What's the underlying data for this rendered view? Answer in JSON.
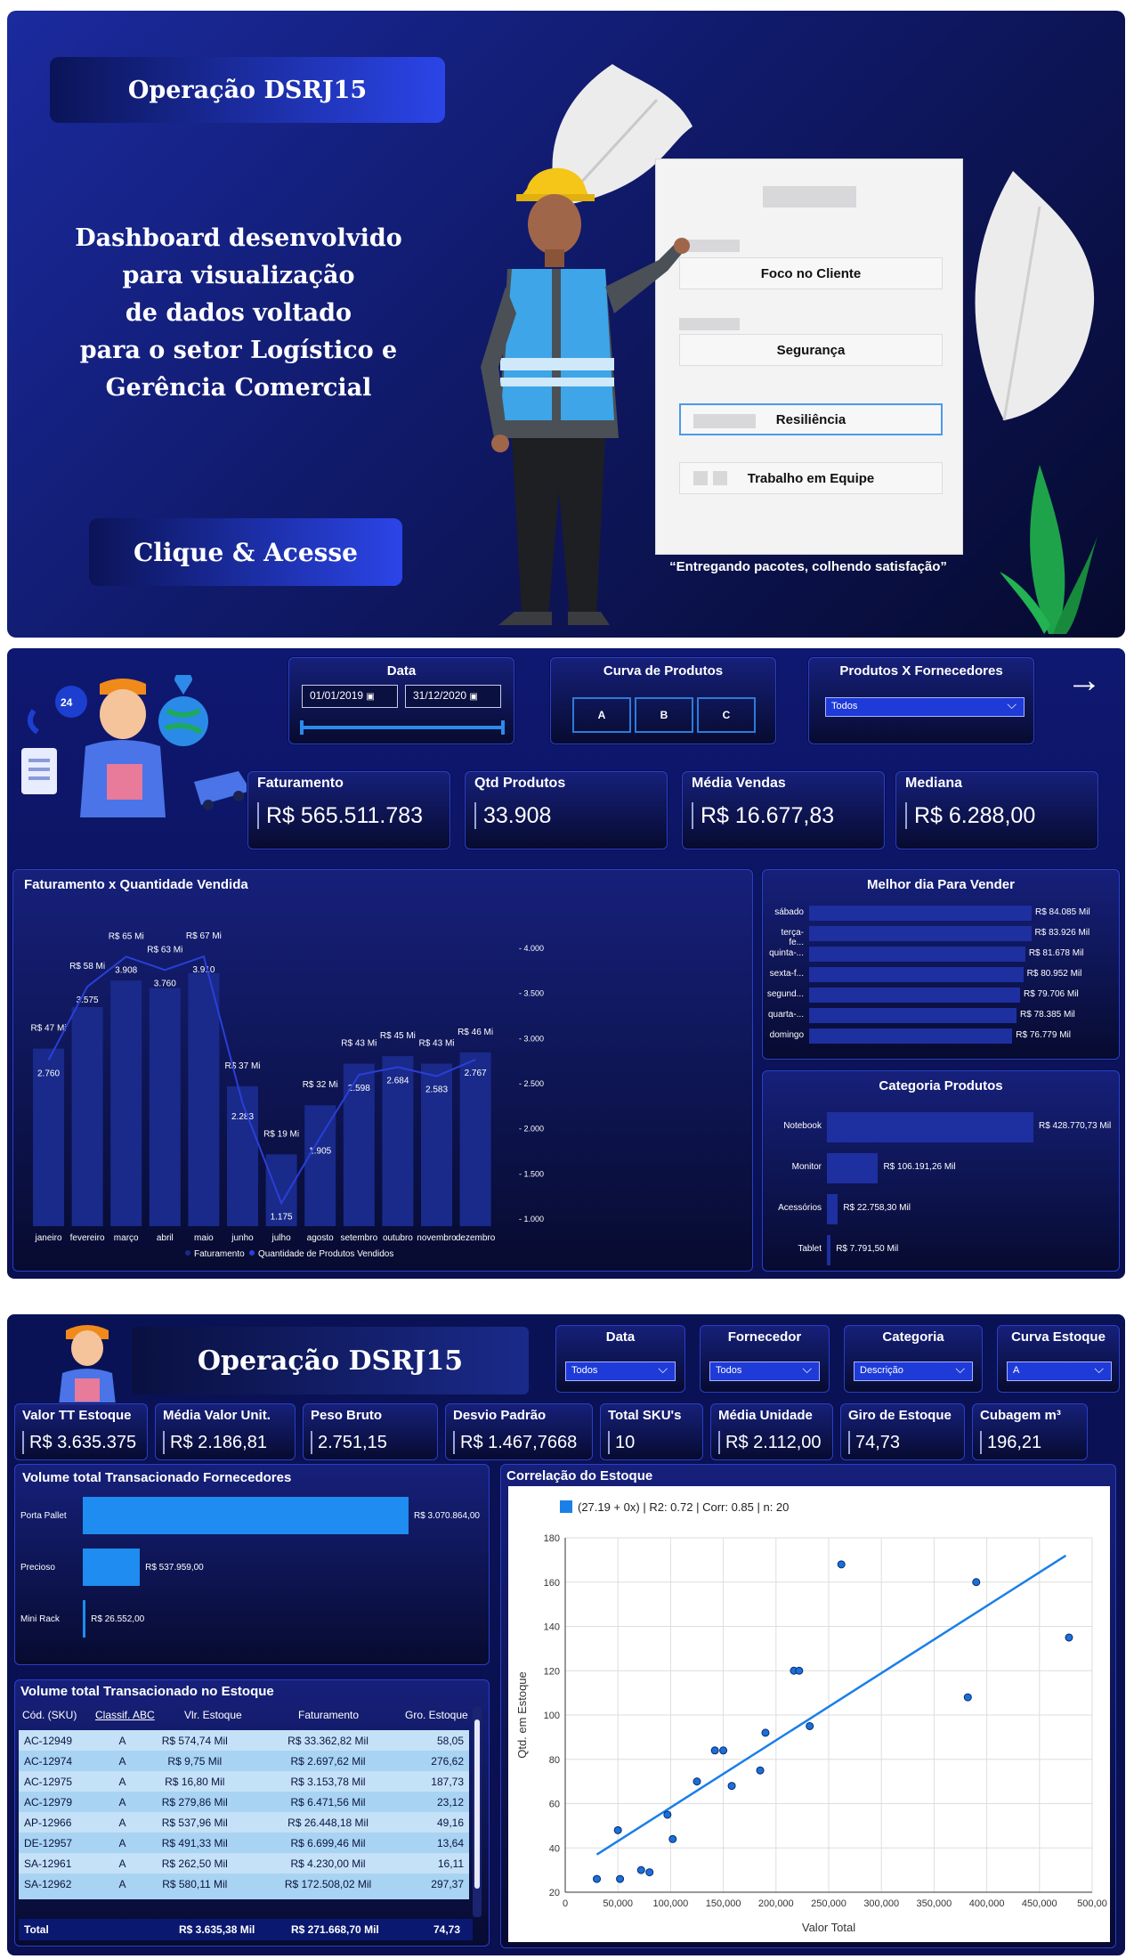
{
  "cover": {
    "title": "Operação DSRJ15",
    "description_lines": [
      "Dashboard desenvolvido",
      "para visualização",
      "de dados voltado",
      "para o setor Logístico e",
      "Gerência Comercial"
    ],
    "cta": "Clique & Acesse",
    "doc_fields": [
      "Foco no Cliente",
      "Segurança",
      "Resiliência",
      "Trabalho em Equipe"
    ],
    "quote": "“Entregando  pacotes, colhendo satisfação”"
  },
  "sales": {
    "filters": {
      "date_title": "Data",
      "date_from": "01/01/2019",
      "date_to": "31/12/2020",
      "curve_title": "Curva de Produtos",
      "curve_tiles": [
        "A",
        "B",
        "C"
      ],
      "supplier_title": "Produtos X Fornecedores",
      "supplier_value": "Todos",
      "arrow": "→"
    },
    "kpis": [
      {
        "title": "Faturamento",
        "value": "R$ 565.511.783"
      },
      {
        "title": "Qtd Produtos",
        "value": "33.908"
      },
      {
        "title": "Média Vendas",
        "value": "R$ 16.677,83"
      },
      {
        "title": "Mediana",
        "value": "R$ 6.288,00"
      }
    ],
    "revenue_title": "Faturamento x Quantidade Vendida",
    "best_day_title": "Melhor dia Para Vender",
    "category_title": "Categoria Produtos"
  },
  "stock": {
    "title": "Operação DSRJ15",
    "filters": [
      {
        "title": "Data",
        "value": "Todos"
      },
      {
        "title": "Fornecedor",
        "value": "Todos"
      },
      {
        "title": "Categoria",
        "value": "Descrição"
      },
      {
        "title": "Curva Estoque",
        "value": "A"
      }
    ],
    "kpis": [
      {
        "title": "Valor TT Estoque",
        "value": "R$ 3.635.375"
      },
      {
        "title": "Média Valor Unit.",
        "value": "R$ 2.186,81"
      },
      {
        "title": "Peso Bruto",
        "value": "2.751,15"
      },
      {
        "title": "Desvio Padrão",
        "value": "R$ 1.467,7668"
      },
      {
        "title": "Total SKU's",
        "value": "10"
      },
      {
        "title": "Média Unidade",
        "value": "R$ 2.112,00"
      },
      {
        "title": "Giro de Estoque",
        "value": "74,73"
      },
      {
        "title": "Cubagem m³",
        "value": "196,21"
      }
    ],
    "supplier_volume_title": "Volume total Transacionado Fornecedores",
    "table": {
      "title": "Volume total Transacionado no Estoque",
      "headers": [
        "Cód. (SKU)",
        "Classif. ABC",
        "Vlr. Estoque",
        "Faturamento",
        "Gro. Estoque"
      ],
      "rows": [
        [
          "AC-12949",
          "A",
          "R$ 574,74 Mil",
          "R$ 33.362,82 Mil",
          "58,05"
        ],
        [
          "AC-12974",
          "A",
          "R$ 9,75 Mil",
          "R$ 2.697,62 Mil",
          "276,62"
        ],
        [
          "AC-12975",
          "A",
          "R$ 16,80 Mil",
          "R$ 3.153,78 Mil",
          "187,73"
        ],
        [
          "AC-12979",
          "A",
          "R$ 279,86 Mil",
          "R$ 6.471,56 Mil",
          "23,12"
        ],
        [
          "AP-12966",
          "A",
          "R$ 537,96 Mil",
          "R$ 26.448,18 Mil",
          "49,16"
        ],
        [
          "DE-12957",
          "A",
          "R$ 491,33 Mil",
          "R$ 6.699,46 Mil",
          "13,64"
        ],
        [
          "SA-12961",
          "A",
          "R$ 262,50 Mil",
          "R$ 4.230,00 Mil",
          "16,11"
        ],
        [
          "SA-12962",
          "A",
          "R$ 580,11 Mil",
          "R$ 172.508,02 Mil",
          "297,37"
        ]
      ],
      "total": [
        "Total",
        "",
        "R$ 3.635,38 Mil",
        "R$ 271.668,70 Mil",
        "74,73"
      ]
    },
    "scatter_title": "Correlação do Estoque"
  },
  "chart_data": [
    {
      "type": "bar",
      "title": "Faturamento x Quantidade Vendida",
      "categories": [
        "janeiro",
        "fevereiro",
        "março",
        "abril",
        "maio",
        "junho",
        "julho",
        "agosto",
        "setembro",
        "outubro",
        "novembro",
        "dezembro"
      ],
      "series": [
        {
          "name": "Faturamento",
          "values": [
            47,
            58,
            65,
            63,
            67,
            37,
            19,
            32,
            43,
            45,
            43,
            46
          ],
          "labels": [
            "R$ 47 Mi",
            "R$ 58 Mi",
            "R$ 65 Mi",
            "R$ 63 Mi",
            "R$ 67 Mi",
            "R$ 37 Mi",
            "R$ 19 Mi",
            "R$ 32 Mi",
            "R$ 43 Mi",
            "R$ 45 Mi",
            "R$ 43 Mi",
            "R$ 46 Mi"
          ],
          "color": "#1a2a8a"
        },
        {
          "name": "Quantidade de Produtos Vendidos",
          "type": "line",
          "values": [
            2760,
            3575,
            3908,
            3760,
            3910,
            2283,
            1175,
            1905,
            2598,
            2684,
            2583,
            2767
          ],
          "labels": [
            "2.760",
            "3.575",
            "3.908",
            "3.760",
            "3.910",
            "2.283",
            "1.175",
            "1.905",
            "2.598",
            "2.684",
            "2.583",
            "2.767"
          ],
          "color": "#2a3fd8"
        }
      ],
      "y2_ticks": [
        "4.000",
        "3.500",
        "3.000",
        "2.500",
        "2.000",
        "1.500",
        "1.000"
      ],
      "y2lim": [
        1000,
        4000
      ],
      "legend": "bottom"
    },
    {
      "type": "bar",
      "orientation": "horizontal",
      "title": "Melhor dia Para Vender",
      "categories": [
        "sábado",
        "terça-fe...",
        "quinta-...",
        "sexta-f...",
        "segund...",
        "quarta-...",
        "domingo"
      ],
      "values": [
        84085,
        83926,
        81678,
        80952,
        79706,
        78385,
        76779
      ],
      "labels": [
        "R$ 84.085 Mil",
        "R$ 83.926 Mil",
        "R$ 81.678 Mil",
        "R$ 80.952 Mil",
        "R$ 79.706 Mil",
        "R$ 78.385 Mil",
        "R$ 76.779 Mil"
      ]
    },
    {
      "type": "bar",
      "orientation": "horizontal",
      "title": "Categoria Produtos",
      "categories": [
        "Notebook",
        "Monitor",
        "Acessórios",
        "Tablet"
      ],
      "values": [
        428770.73,
        106191.26,
        22758.3,
        7791.5
      ],
      "labels": [
        "R$ 428.770,73 Mil",
        "R$ 106.191,26 Mil",
        "R$ 22.758,30 Mil",
        "R$ 7.791,50 Mil"
      ]
    },
    {
      "type": "bar",
      "orientation": "horizontal",
      "title": "Volume total Transacionado Fornecedores",
      "categories": [
        "Porta Pallet",
        "Precioso",
        "Mini Rack"
      ],
      "values": [
        3070864.0,
        537959.0,
        26552.0
      ],
      "labels": [
        "R$ 3.070.864,00",
        "R$ 537.959,00",
        "R$ 26.552,00"
      ],
      "color": "#1e8cf0"
    },
    {
      "type": "scatter",
      "title": "Correlação do Estoque",
      "xlabel": "Valor Total",
      "ylabel": "Qtd. em Estoque",
      "legend": "(27.19 + 0x) | R2: 0.72 | Corr: 0.85 | n: 20",
      "xlim": [
        0,
        500000
      ],
      "ylim": [
        20,
        180
      ],
      "x_ticks": [
        "0",
        "50,000",
        "100,000",
        "150,000",
        "200,000",
        "250,000",
        "300,000",
        "350,000",
        "400,000",
        "450,000",
        "500,00"
      ],
      "y_ticks": [
        "20",
        "40",
        "60",
        "80",
        "100",
        "120",
        "140",
        "160",
        "180"
      ],
      "points": [
        [
          30000,
          26
        ],
        [
          50000,
          48
        ],
        [
          52000,
          26
        ],
        [
          72000,
          30
        ],
        [
          80000,
          29
        ],
        [
          97000,
          55
        ],
        [
          102000,
          44
        ],
        [
          125000,
          70
        ],
        [
          142000,
          84
        ],
        [
          150000,
          84
        ],
        [
          158000,
          68
        ],
        [
          185000,
          75
        ],
        [
          190000,
          92
        ],
        [
          217000,
          120
        ],
        [
          222000,
          120
        ],
        [
          232000,
          95
        ],
        [
          262000,
          168
        ],
        [
          382000,
          108
        ],
        [
          390000,
          160
        ],
        [
          478000,
          135
        ]
      ],
      "trend": [
        [
          30000,
          37
        ],
        [
          475000,
          172
        ]
      ],
      "color": "#1a7fe8"
    }
  ]
}
